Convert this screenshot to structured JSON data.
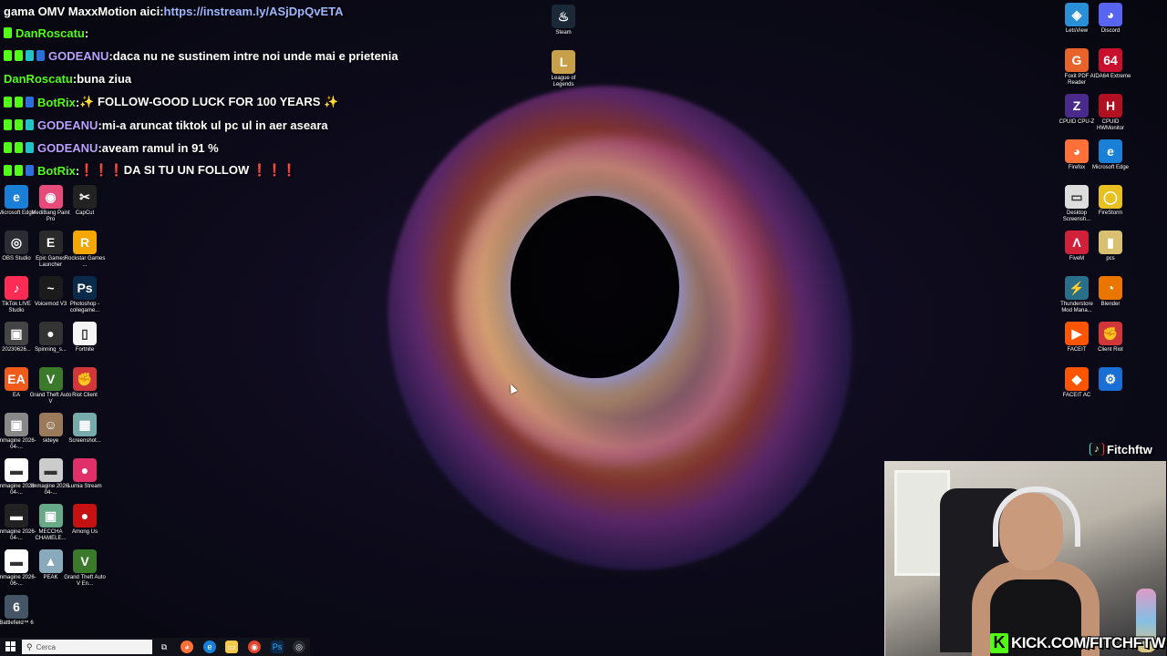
{
  "chat": {
    "line1": {
      "prefix": "gama OMV MaxxMotion aici: ",
      "link": "https://instream.ly/ASjDpQvETA"
    },
    "line2": {
      "user": "DanRoscatu",
      "sep": " :",
      "message": ""
    },
    "line3": {
      "user": "GODEANU",
      "sep": " : ",
      "message": "daca nu ne sustinem intre noi unde mai e prietenia"
    },
    "line4": {
      "user": "DanRoscatu",
      "sep": " : ",
      "message": "buna ziua"
    },
    "line5": {
      "user": "BotRix",
      "sep": " : ",
      "message": "✨ FOLLOW-GOOD LUCK FOR 100 YEARS ✨"
    },
    "line6": {
      "user": "GODEANU",
      "sep": " : ",
      "message": "mi-a aruncat tiktok ul pc ul in aer aseara"
    },
    "line7": {
      "user": "GODEANU",
      "sep": " : ",
      "message": "aveam ramul in 91 %"
    },
    "line8": {
      "user": "BotRix",
      "sep": " : ",
      "message": "❗❗❗DA SI TU UN FOLLOW ❗❗❗"
    }
  },
  "desktop_left": [
    {
      "label": "Microsoft Edge",
      "glyph": "e",
      "color": "#1a7fd6"
    },
    {
      "label": "MediBang Paint Pro",
      "glyph": "◉",
      "color": "#e84a7a"
    },
    {
      "label": "CapCut",
      "glyph": "✂",
      "color": "#222222"
    },
    {
      "label": "OBS Studio",
      "glyph": "◎",
      "color": "#2c2c34"
    },
    {
      "label": "Epic Games Launcher",
      "glyph": "E",
      "color": "#2a2a2a"
    },
    {
      "label": "Rockstar Games ...",
      "glyph": "R",
      "color": "#f4a700"
    },
    {
      "label": "TikTok LIVE Studio",
      "glyph": "♪",
      "color": "#fe2c55"
    },
    {
      "label": "Voicemod V3",
      "glyph": "~",
      "color": "#1b1b1b"
    },
    {
      "label": "Photoshop - collegame...",
      "glyph": "Ps",
      "color": "#0b2a4a"
    },
    {
      "label": "20230626...",
      "glyph": "▣",
      "color": "#444444"
    },
    {
      "label": "Spinning_s...",
      "glyph": "●",
      "color": "#333333"
    },
    {
      "label": "Fortnite",
      "glyph": "▯",
      "color": "#f5f5f5"
    },
    {
      "label": "EA",
      "glyph": "EA",
      "color": "#f05a1a"
    },
    {
      "label": "Grand Theft Auto V",
      "glyph": "V",
      "color": "#3a7a2a"
    },
    {
      "label": "Riot Client",
      "glyph": "✊",
      "color": "#d13639"
    },
    {
      "label": "Immagine 2026-04-...",
      "glyph": "▣",
      "color": "#888888"
    },
    {
      "label": "sideye",
      "glyph": "☺",
      "color": "#9a7a5a"
    },
    {
      "label": "Screenshot...",
      "glyph": "▦",
      "color": "#7aa"
    },
    {
      "label": "Immagine 2026-04-...",
      "glyph": "▬",
      "color": "#ffffff"
    },
    {
      "label": "Immagine 2026-04-...",
      "glyph": "▬",
      "color": "#cccccc"
    },
    {
      "label": "Lumia Stream",
      "glyph": "●",
      "color": "#e0306a"
    },
    {
      "label": "Immagine 2026-04-...",
      "glyph": "▬",
      "color": "#222222"
    },
    {
      "label": "MECCHA CHAMELE...",
      "glyph": "▣",
      "color": "#6a8"
    },
    {
      "label": "Among Us",
      "glyph": "●",
      "color": "#c51111"
    },
    {
      "label": "Immagine 2026-06-...",
      "glyph": "▬",
      "color": "#ffffff"
    },
    {
      "label": "PEAK",
      "glyph": "▲",
      "color": "#8ab"
    },
    {
      "label": "Grand Theft Auto V En...",
      "glyph": "V",
      "color": "#3a7a2a"
    },
    {
      "label": "Battlefield™ 6",
      "glyph": "6",
      "color": "#445566"
    }
  ],
  "desktop_center": [
    {
      "label": "Steam",
      "glyph": "♨",
      "color": "#1b2838"
    },
    {
      "label": "League of Legends",
      "glyph": "L",
      "color": "#c8a04a"
    }
  ],
  "desktop_right": [
    {
      "label": "LetsView",
      "glyph": "◈",
      "color": "#2a8fd6"
    },
    {
      "label": "Discord",
      "glyph": "◕",
      "color": "#5865f2"
    },
    {
      "label": "Foxit PDF Reader",
      "glyph": "G",
      "color": "#e8632a"
    },
    {
      "label": "AIDA64 Extreme",
      "glyph": "64",
      "color": "#c8102e"
    },
    {
      "label": "CPUID CPU-Z",
      "glyph": "Z",
      "color": "#4a2a8a"
    },
    {
      "label": "CPUID HWMonitor",
      "glyph": "H",
      "color": "#b01020"
    },
    {
      "label": "Firefox",
      "glyph": "◕",
      "color": "#ff7139"
    },
    {
      "label": "Microsoft Edge",
      "glyph": "e",
      "color": "#1a7fd6"
    },
    {
      "label": "Desktop Screensh...",
      "glyph": "▭",
      "color": "#dddddd"
    },
    {
      "label": "FireStorm",
      "glyph": "◯",
      "color": "#e8c020"
    },
    {
      "label": "FiveM",
      "glyph": "Λ",
      "color": "#d0203a"
    },
    {
      "label": "pcs",
      "glyph": "▮",
      "color": "#d8c070"
    },
    {
      "label": "Thunderstore Mod Mana...",
      "glyph": "⚡",
      "color": "#2a6f8a"
    },
    {
      "label": "Blender",
      "glyph": "◔",
      "color": "#ea7600"
    },
    {
      "label": "FACEIT",
      "glyph": "▶",
      "color": "#ff5500"
    },
    {
      "label": "Client Riot",
      "glyph": "✊",
      "color": "#d13639"
    },
    {
      "label": "FACEIT AC",
      "glyph": "◆",
      "color": "#ff5500"
    },
    {
      "label": "",
      "glyph": "⚙",
      "color": "#1a6fd6"
    }
  ],
  "overlay": {
    "tiktok_handle": "Fitchftw",
    "kick_url": "KICK.COM/FITCHFTW",
    "kick_logo": "K"
  },
  "taskbar": {
    "search_placeholder": "Cerca",
    "icons": [
      "task-view-icon",
      "firefox-icon",
      "edge-icon",
      "file-explorer-icon",
      "chrome-icon",
      "photoshop-icon",
      "obs-icon"
    ]
  },
  "colors": {
    "kick_green": "#53fc18",
    "chat_user_green": "#53fc18",
    "chat_user_purple": "#b9a0ff",
    "link": "#9fb7ff"
  }
}
